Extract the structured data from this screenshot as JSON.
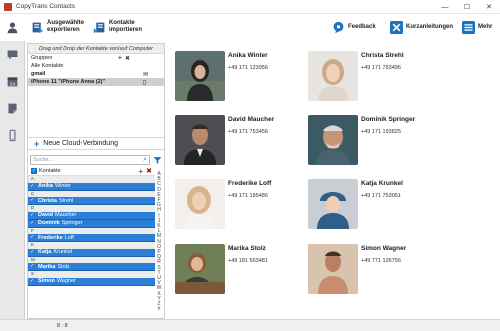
{
  "window": {
    "title": "CopyTrans Contacts",
    "controls": [
      "—",
      "☐",
      "✕"
    ]
  },
  "toolbar": {
    "export_label_1": "Ausgewählte",
    "export_label_2": "exportieren",
    "import_label_1": "Kontakte",
    "import_label_2": "importieren",
    "feedback_label": "Feedback",
    "guides_label": "Kurzanleitungen",
    "more_label": "Mehr"
  },
  "accounts": {
    "drag_hint": "Drag und Drop der Kontakte von/auf Computer",
    "groups_label": "Gruppen",
    "all_contacts_label": "Alle Kontakte",
    "gmail_label": "gmail",
    "iphone_label": "iPhone 11 \"iPhone Anna (2)\"",
    "new_cloud_label": "Neue Cloud-Verbindung"
  },
  "search": {
    "placeholder": "Suche..."
  },
  "list": {
    "header_label": "Kontakte",
    "groups": [
      {
        "letter": "A",
        "first": "Anika",
        "last": "Winter"
      },
      {
        "letter": "C",
        "first": "Christa",
        "last": "Strehl"
      },
      {
        "letter": "D",
        "first": "David",
        "last": "Maucher"
      },
      {
        "letter": "",
        "first": "Dominik",
        "last": "Springer"
      },
      {
        "letter": "F",
        "first": "Frederike",
        "last": "Loff"
      },
      {
        "letter": "K",
        "first": "Katja",
        "last": "Krunkel"
      },
      {
        "letter": "M",
        "first": "Marika",
        "last": "Stolz"
      },
      {
        "letter": "S",
        "first": "Simon",
        "last": "Wagner"
      }
    ],
    "alphabet": [
      "A",
      "B",
      "C",
      "D",
      "E",
      "F",
      "G",
      "H",
      "I",
      "J",
      "K",
      "L",
      "M",
      "N",
      "O",
      "P",
      "Q",
      "R",
      "S",
      "T",
      "U",
      "V",
      "W",
      "X",
      "Y",
      "Z",
      "#"
    ]
  },
  "contacts": [
    {
      "name": "Anika Winter",
      "phone": "+49 171 123956"
    },
    {
      "name": "Christa Strehl",
      "phone": "+49 171 783496"
    },
    {
      "name": "David Maucher",
      "phone": "+49 171 753456"
    },
    {
      "name": "Dominik Springer",
      "phone": "+49 171 193825"
    },
    {
      "name": "Frederike Loff",
      "phone": "+49 171 185486"
    },
    {
      "name": "Katja Krunkel",
      "phone": "+49 171 753051"
    },
    {
      "name": "Marika Stolz",
      "phone": "+49 181 563481"
    },
    {
      "name": "Simon Wagner",
      "phone": "+49 771 126756"
    }
  ],
  "status": {
    "count": "8 : 8"
  },
  "colors": {
    "accent": "#1e73be",
    "selection": "#2b7fd6",
    "delete": "#cc0000"
  }
}
